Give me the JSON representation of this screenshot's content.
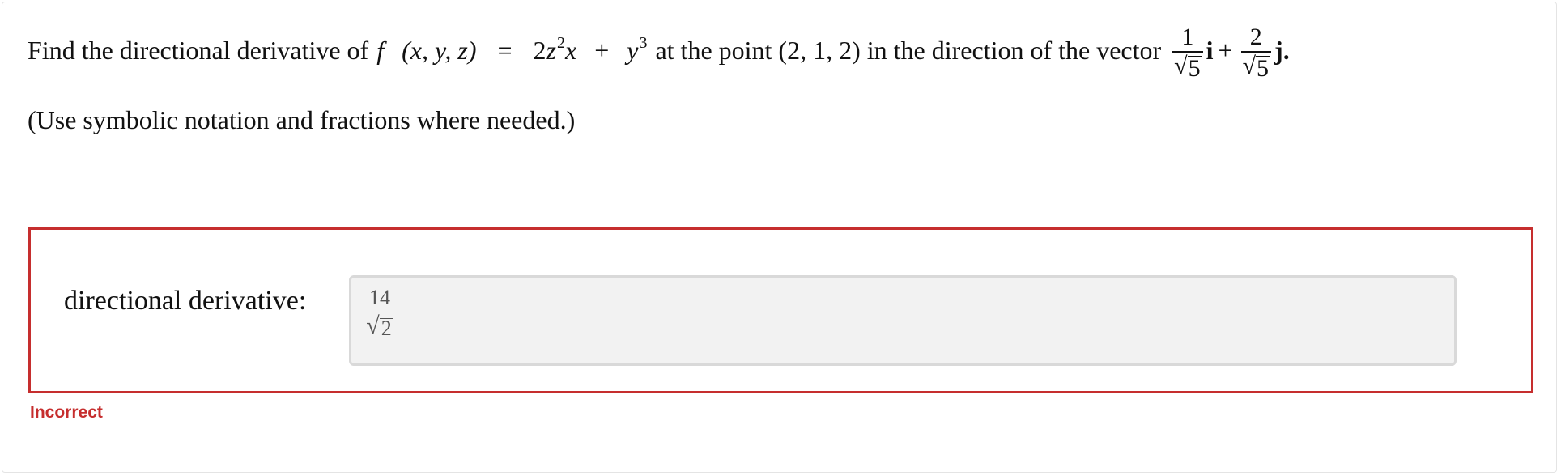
{
  "question": {
    "lead_text": "Find the directional derivative of",
    "func_name": "f",
    "func_args": "(x, y, z)",
    "equals": "=",
    "expr_coef": "2",
    "expr_var1": "z",
    "expr_exp1": "2",
    "expr_var2": "x",
    "plus": "+",
    "expr_var3": "y",
    "expr_exp2": "3",
    "mid_text": "at the point (2, 1, 2) in the direction of the vector",
    "vec_i_num": "1",
    "vec_i_den_rad": "5",
    "vec_i_unit": "i",
    "vec_plus": "+",
    "vec_j_num": "2",
    "vec_j_den_rad": "5",
    "vec_j_unit": "j",
    "end_punct": "."
  },
  "note": "(Use symbolic notation and fractions where needed.)",
  "answer": {
    "label": "directional derivative:",
    "value_num": "14",
    "value_den_rad": "2"
  },
  "status": {
    "text": "Incorrect",
    "color": "#c62e2e"
  }
}
